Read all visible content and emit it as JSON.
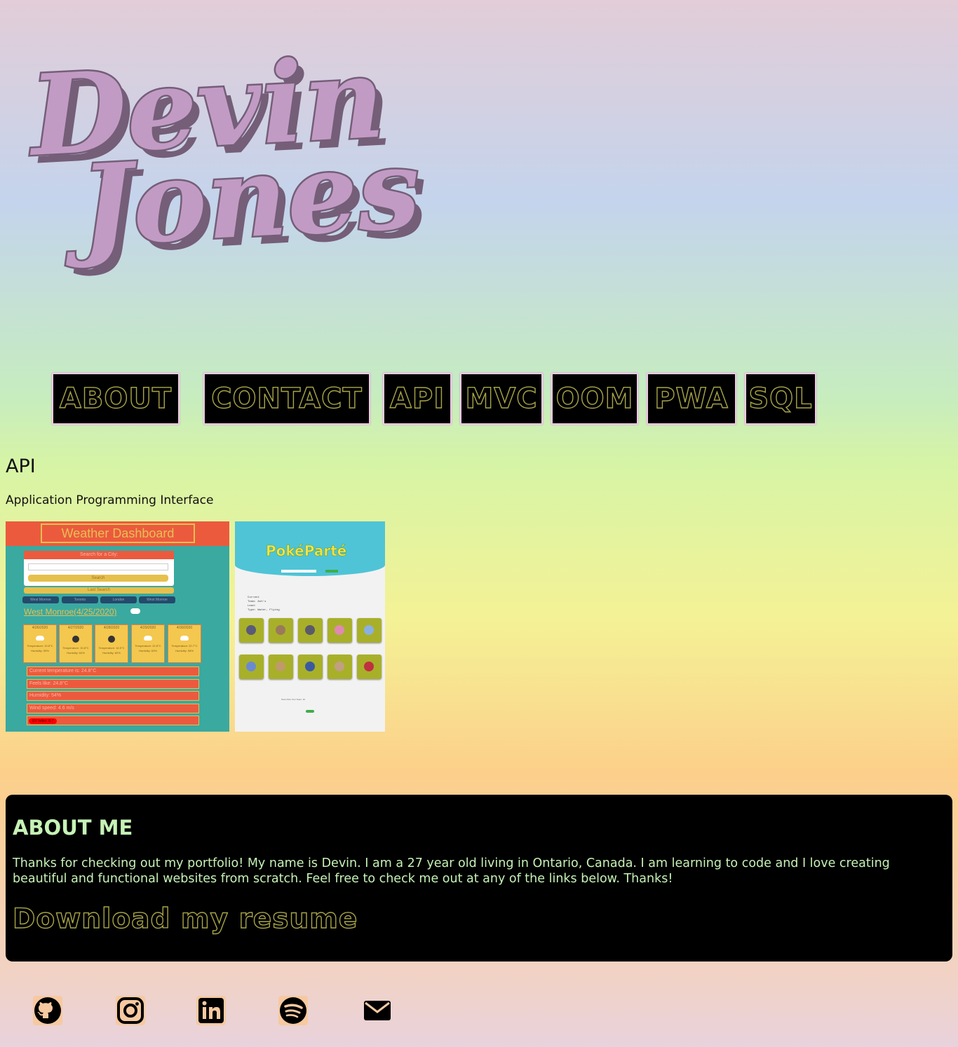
{
  "logo": {
    "line1": "Devin",
    "line2": "Jones"
  },
  "nav": {
    "items": [
      {
        "label": "ABOUT"
      },
      {
        "label": "CONTACT"
      },
      {
        "label": "API"
      },
      {
        "label": "MVC"
      },
      {
        "label": "OOM"
      },
      {
        "label": "PWA"
      },
      {
        "label": "SQL"
      }
    ]
  },
  "section": {
    "title": "API",
    "subtitle": "Application Programming Interface"
  },
  "projects": {
    "weather": {
      "title": "Weather Dashboard",
      "search_label": "Search for a City:",
      "search_button": "Search",
      "last_searched": "Last Search",
      "cities": [
        "West Monroe",
        "Toronto",
        "London",
        "West Monroe"
      ],
      "location": "West Monroe(4/25/2020)",
      "forecast": [
        {
          "date": "4/26/2020",
          "icon": "partly-cloudy-icon",
          "temp": "Temperature: 19.8°C",
          "humidity": "Humidity: 55%"
        },
        {
          "date": "4/27/2020",
          "icon": "moon-icon",
          "temp": "Temperature: 15.8°C",
          "humidity": "Humidity: 64%"
        },
        {
          "date": "4/28/2020",
          "icon": "moon-icon",
          "temp": "Temperature: 16.5°C",
          "humidity": "Humidity: 82%"
        },
        {
          "date": "4/29/2020",
          "icon": "partly-cloudy-icon",
          "temp": "Temperature: 22.8°C",
          "humidity": "Humidity: 63%"
        },
        {
          "date": "4/30/2020",
          "icon": "partly-cloudy-icon",
          "temp": "Temperature: 22.7°C",
          "humidity": "Humidity: 58%"
        }
      ],
      "rows": [
        "Current temperature is: 24.8°C",
        "Feels like: 24.8°C",
        "Humidity: 54%",
        "Wind speed: 4.6 m/s"
      ],
      "uv": "UV Index: 8.7"
    },
    "poke": {
      "logo": "PokéParté",
      "info_lines": [
        "Current",
        "Team: Ash's",
        "Lead:",
        "Type: Water, Flying"
      ],
      "footer": "Team Size   Your Team: 10",
      "poke_colors": [
        "#5a5a7a",
        "#9a7a5a",
        "#5a5a6a",
        "#e08ab0",
        "#8ab0e0",
        "#6a8ad0",
        "#c09a6a",
        "#3a5aa0",
        "#c0a080",
        "#c03040"
      ]
    }
  },
  "about": {
    "title": "ABOUT ME",
    "text": "Thanks for checking out my portfolio! My name is Devin. I am a 27 year old living in Ontario, Canada. I am learning to code and I love creating beautiful and functional websites from scratch. Feel free to check me out at any of the links below. Thanks!",
    "resume": "Download my resume"
  },
  "social": [
    {
      "name": "github-icon"
    },
    {
      "name": "instagram-icon"
    },
    {
      "name": "linkedin-icon"
    },
    {
      "name": "spotify-icon"
    },
    {
      "name": "email-icon"
    }
  ],
  "colors": {
    "logo_fill": "#c29bc4",
    "logo_shadow": "#745e78",
    "nav_stroke": "#a8a448",
    "about_text": "#c6f2b6"
  }
}
